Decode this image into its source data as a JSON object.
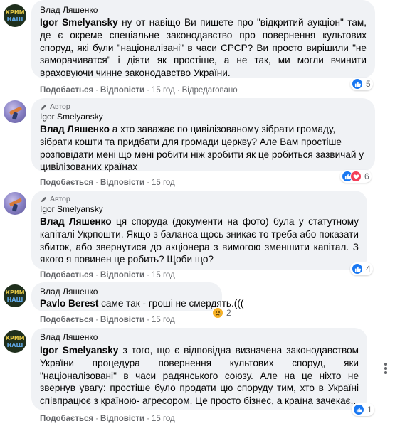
{
  "comments": [
    {
      "author": "Влад Ляшенко",
      "is_author": false,
      "mention": "Igor Smelyansky",
      "text": " ну от навіщо Ви пишете про \"відкритий аукціон\" там, де є окреме спеціальне законодавство про повернення культових споруд, які були \"націоналізані\" в часи СРСР? Ви просто вирішили \"не заморачиватся\" і діяти як простіше, а не так, ми могли вчинити враховуючи чинне законодавство України.",
      "like": "Подобається",
      "reply": "Відповісти",
      "time": "15 год",
      "edited": "Відредаговано",
      "reaction_count": "5",
      "reactions": [
        "like"
      ]
    },
    {
      "author": "Igor Smelyansky",
      "is_author": true,
      "author_badge": "Автор",
      "mention": "Влад Ляшенко",
      "text": " а хто заважає по цивілізованому зібрати громаду, зібрати кошти та придбати для громади церкву? Але Вам простіше розповідати мені що мені робити ніж зробити як це робиться зазвичай у цивілізованих країнах",
      "like": "Подобається",
      "reply": "Відповісти",
      "time": "15 год",
      "reaction_count": "6",
      "reactions": [
        "like",
        "love"
      ]
    },
    {
      "author": "Igor Smelyansky",
      "is_author": true,
      "author_badge": "Автор",
      "mention": "Влад Ляшенко",
      "text": " ця споруда (документи на фото) була у статутному капіталі Укрпошти. Якщо з баланса щось зникає то треба або показати збиток, або звернутися до акціонера з вимогою зменшити капітал. З якого я повинен це робить? Щоби що?",
      "like": "Подобається",
      "reply": "Відповісти",
      "time": "15 год",
      "reaction_count": "4",
      "reactions": [
        "like"
      ]
    },
    {
      "author": "Влад Ляшенко",
      "is_author": false,
      "mention": "Pavlo Berest",
      "text": " саме так - гроші не смердять.(((",
      "like": "Подобається",
      "reply": "Відповісти",
      "time": "15 год",
      "reaction_count": "2",
      "reactions": [
        "sad"
      ]
    },
    {
      "author": "Влад Ляшенко",
      "is_author": false,
      "mention": "Igor Smelyansky",
      "text": " з того, що є відповідна визначена законодавством України процедура повернення культових споруд, яки \"націоналізовані\" в часи радянського союзу. Але на це ніхто не звернув увагу: простіше було продати цю споруду тим, хто в Україні співпрацює з країною- агресором. Це просто бізнес, а країна зачекає...",
      "like": "Подобається",
      "reply": "Відповісти",
      "time": "15 год",
      "reaction_count": "1",
      "reactions": [
        "like"
      ]
    }
  ],
  "avatar_text": {
    "line1": "КРИМ",
    "line2": "НАШ"
  },
  "colors": {
    "bubble": "#f0f2f5",
    "meta": "#65676b",
    "like": "#1877f2",
    "love": "#f33e58",
    "sad": "#f7b125"
  }
}
